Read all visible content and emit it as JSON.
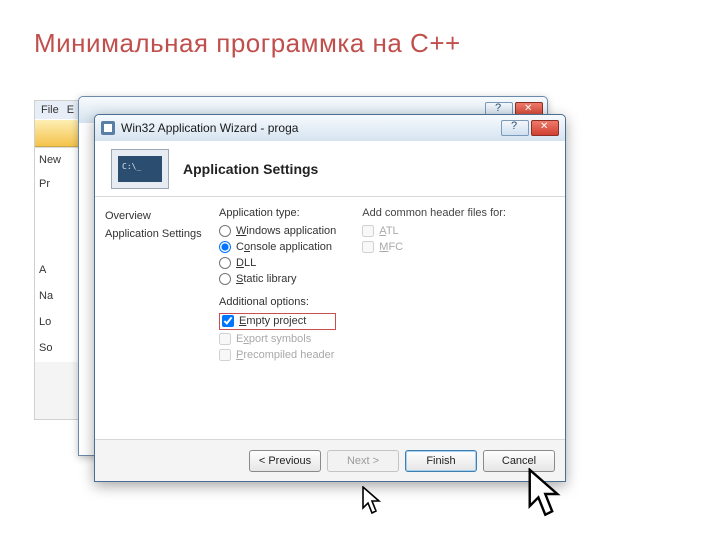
{
  "slide": {
    "title": "Минимальная программка на C++"
  },
  "bg": {
    "menu": {
      "file": "File",
      "e": "E"
    },
    "panels": {
      "new": "New",
      "pr": "Pr",
      "a": "A",
      "na": "Na",
      "lo": "Lo",
      "so": "So"
    }
  },
  "win": {
    "title": "Win32 Application Wizard - proga",
    "banner": "Application Settings",
    "thumb": "C:\\_",
    "side": {
      "overview": "Overview",
      "appset": "Application Settings"
    },
    "apptype": {
      "label": "Application type:",
      "windows": "Windows application",
      "console": "Console application",
      "dll": "DLL",
      "static": "Static library"
    },
    "addopt": {
      "label": "Additional options:",
      "empty": "Empty project",
      "export": "Export symbols",
      "precomp": "Precompiled header"
    },
    "common": {
      "label": "Add common header files for:",
      "atl": "ATL",
      "mfc": "MFC"
    },
    "buttons": {
      "prev": "< Previous",
      "next": "Next >",
      "finish": "Finish",
      "cancel": "Cancel"
    }
  }
}
